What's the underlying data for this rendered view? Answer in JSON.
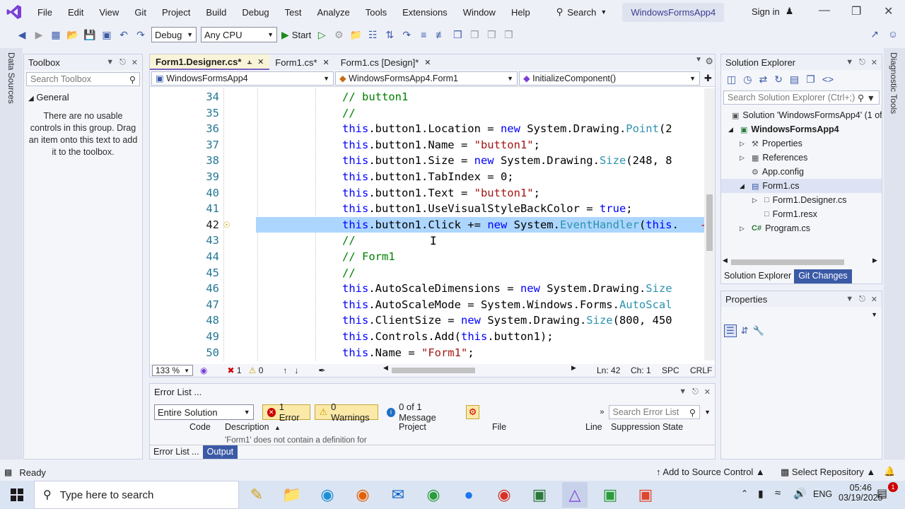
{
  "menu": [
    "File",
    "Edit",
    "View",
    "Git",
    "Project",
    "Build",
    "Debug",
    "Test",
    "Analyze",
    "Tools",
    "Extensions",
    "Window",
    "Help"
  ],
  "search_label": "Search",
  "window_title": "WindowsFormsApp4",
  "signin": "Sign in",
  "toolbar": {
    "config": "Debug",
    "platform": "Any CPU",
    "start": "Start"
  },
  "left_strip": "Data Sources",
  "right_strip": "Diagnostic Tools",
  "toolbox": {
    "title": "Toolbox",
    "search_placeholder": "Search Toolbox",
    "group": "General",
    "message": "There are no usable controls in this group. Drag an item onto this text to add it to the toolbox."
  },
  "editor": {
    "tabs": [
      {
        "label": "Form1.Designer.cs*",
        "active": true
      },
      {
        "label": "Form1.cs*",
        "active": false
      },
      {
        "label": "Form1.cs [Design]*",
        "active": false
      }
    ],
    "nav": [
      "WindowsFormsApp4",
      "WindowsFormsApp4.Form1",
      "InitializeComponent()"
    ],
    "lines": [
      {
        "n": "34",
        "tokens": [
          [
            "cm",
            "// button1"
          ]
        ]
      },
      {
        "n": "35",
        "tokens": [
          [
            "cm",
            "//"
          ]
        ]
      },
      {
        "n": "36",
        "tokens": [
          [
            "kw",
            "this"
          ],
          [
            "",
            ".button1.Location = "
          ],
          [
            "kw",
            "new"
          ],
          [
            "",
            " System.Drawing."
          ],
          [
            "ty",
            "Point"
          ],
          [
            "",
            "(2"
          ]
        ]
      },
      {
        "n": "37",
        "tokens": [
          [
            "kw",
            "this"
          ],
          [
            "",
            ".button1.Name = "
          ],
          [
            "str",
            "\"button1\""
          ],
          [
            "",
            ";"
          ]
        ]
      },
      {
        "n": "38",
        "tokens": [
          [
            "kw",
            "this"
          ],
          [
            "",
            ".button1.Size = "
          ],
          [
            "kw",
            "new"
          ],
          [
            "",
            " System.Drawing."
          ],
          [
            "ty",
            "Size"
          ],
          [
            "",
            "(248, 8"
          ]
        ]
      },
      {
        "n": "39",
        "tokens": [
          [
            "kw",
            "this"
          ],
          [
            "",
            ".button1.TabIndex = 0;"
          ]
        ]
      },
      {
        "n": "40",
        "tokens": [
          [
            "kw",
            "this"
          ],
          [
            "",
            ".button1.Text = "
          ],
          [
            "str",
            "\"button1\""
          ],
          [
            "",
            ";"
          ]
        ]
      },
      {
        "n": "41",
        "tokens": [
          [
            "kw",
            "this"
          ],
          [
            "",
            ".button1.UseVisualStyleBackColor = "
          ],
          [
            "kw",
            "true"
          ],
          [
            "",
            ";"
          ]
        ]
      },
      {
        "n": "42",
        "tokens": [
          [
            "kw",
            "this"
          ],
          [
            "",
            ".button1.Click += "
          ],
          [
            "kw",
            "new"
          ],
          [
            "",
            " System."
          ],
          [
            "ty",
            "EventHandler"
          ],
          [
            "",
            "("
          ],
          [
            "kw",
            "this"
          ],
          [
            "",
            "."
          ]
        ],
        "selected": true
      },
      {
        "n": "43",
        "tokens": [
          [
            "cm",
            "//"
          ]
        ]
      },
      {
        "n": "44",
        "tokens": [
          [
            "cm",
            "// Form1"
          ]
        ]
      },
      {
        "n": "45",
        "tokens": [
          [
            "cm",
            "//"
          ]
        ]
      },
      {
        "n": "46",
        "tokens": [
          [
            "kw",
            "this"
          ],
          [
            "",
            ".AutoScaleDimensions = "
          ],
          [
            "kw",
            "new"
          ],
          [
            "",
            " System.Drawing."
          ],
          [
            "ty",
            "Size"
          ]
        ]
      },
      {
        "n": "47",
        "tokens": [
          [
            "kw",
            "this"
          ],
          [
            "",
            ".AutoScaleMode = System.Windows.Forms."
          ],
          [
            "ty",
            "AutoScal"
          ]
        ]
      },
      {
        "n": "48",
        "tokens": [
          [
            "kw",
            "this"
          ],
          [
            "",
            ".ClientSize = "
          ],
          [
            "kw",
            "new"
          ],
          [
            "",
            " System.Drawing."
          ],
          [
            "ty",
            "Size"
          ],
          [
            "",
            "(800, 450"
          ]
        ]
      },
      {
        "n": "49",
        "tokens": [
          [
            "kw",
            "this"
          ],
          [
            "",
            ".Controls.Add("
          ],
          [
            "kw",
            "this"
          ],
          [
            "",
            ".button1);"
          ]
        ]
      },
      {
        "n": "50",
        "tokens": [
          [
            "kw",
            "this"
          ],
          [
            "",
            ".Name = "
          ],
          [
            "str",
            "\"Form1\""
          ],
          [
            "",
            ";"
          ]
        ]
      }
    ],
    "zoom": "133 %",
    "errors": "1",
    "warnings": "0",
    "ln": "Ln: 42",
    "ch": "Ch: 1",
    "spc": "SPC",
    "crlf": "CRLF"
  },
  "solution_explorer": {
    "title": "Solution Explorer",
    "search_placeholder": "Search Solution Explorer (Ctrl+;)",
    "items": [
      "Solution 'WindowsFormsApp4' (1 of",
      "WindowsFormsApp4",
      "Properties",
      "References",
      "App.config",
      "Form1.cs",
      "Form1.Designer.cs",
      "Form1.resx",
      "Program.cs"
    ],
    "tabs": [
      "Solution Explorer",
      "Git Changes"
    ]
  },
  "properties": {
    "title": "Properties"
  },
  "error_list": {
    "title": "Error List ...",
    "scope": "Entire Solution",
    "errors_btn": "1 Error",
    "warnings_btn": "0 Warnings",
    "messages_btn": "0 of 1 Message",
    "search_placeholder": "Search Error List",
    "columns": [
      "Code",
      "Description",
      "Project",
      "File",
      "Line",
      "Suppression State"
    ],
    "row_desc": "'Form1' does not contain a definition for",
    "bottom_tabs": [
      "Error List ...",
      "Output"
    ]
  },
  "status": {
    "ready": "Ready",
    "source_control": "Add to Source Control",
    "repo": "Select Repository"
  },
  "taskbar": {
    "search_placeholder": "Type here to search",
    "lang": "ENG",
    "time": "05:46",
    "date": "03/19/2025",
    "notif_count": "1"
  }
}
